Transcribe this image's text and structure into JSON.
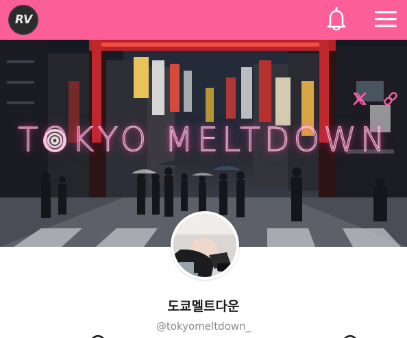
{
  "header": {
    "logo_text": "RV",
    "background_color": "#fc5f97",
    "icons": [
      "notification-bell-icon",
      "hamburger-menu-icon"
    ]
  },
  "banner": {
    "title": "TOKYO MELTDOWN",
    "icons": [
      "x-logo-icon",
      "link-icon"
    ]
  },
  "profile": {
    "name": "도쿄멜트다운",
    "handle": "@tokyomeltdown_"
  }
}
